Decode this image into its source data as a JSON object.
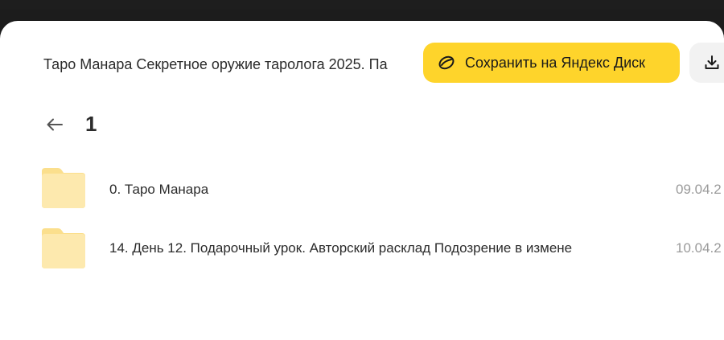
{
  "header": {
    "title": "Таро Манара Секретное оружие таролога 2025. Па",
    "save_label": "Сохранить на Яндекс Диск",
    "save_icon": "yandex-disk-icon",
    "download_icon": "download-icon"
  },
  "folder": {
    "back_icon": "arrow-left-icon",
    "name": "1"
  },
  "items": [
    {
      "icon": "folder-icon",
      "name": "0. Таро Манара",
      "date": "09.04.2"
    },
    {
      "icon": "folder-icon",
      "name": "14. День 12. Подарочный урок. Авторский расклад Подозрение в измене",
      "date": "10.04.2"
    }
  ],
  "colors": {
    "accent": "#fed42b",
    "folder": "#fde8a8",
    "text": "#2b2b2b",
    "muted": "#9a9a9a"
  }
}
